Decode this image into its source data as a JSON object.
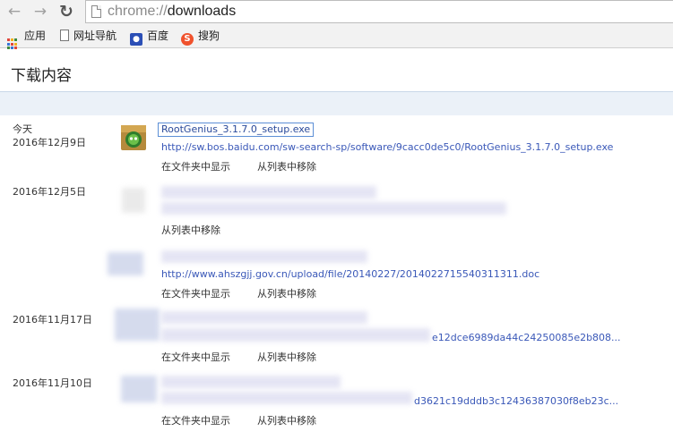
{
  "toolbar": {
    "url_scheme": "chrome://",
    "url_host": "downloads"
  },
  "bookmarks": [
    {
      "label": "应用",
      "icon": "apps-grid-icon"
    },
    {
      "label": "网址导航",
      "icon": "page-icon"
    },
    {
      "label": "百度",
      "icon": "baidu-paw-icon"
    },
    {
      "label": "搜狗",
      "icon": "sogou-icon"
    }
  ],
  "page": {
    "title": "下载内容"
  },
  "downloads": [
    {
      "date_top": "今天",
      "date": "2016年12月9日",
      "file_name": "RootGenius_3.1.7.0_setup.exe",
      "url": "http://sw.bos.baidu.com/sw-search-sp/software/9cacc0de5c0/RootGenius_3.1.7.0_setup.exe",
      "actions": [
        "在文件夹中显示",
        "从列表中移除"
      ]
    },
    {
      "date": "2016年12月5日",
      "actions": [
        "从列表中移除"
      ]
    },
    {
      "url": "http://www.ahszgjj.gov.cn/upload/file/20140227/20140227155403113​11.doc",
      "actions": [
        "在文件夹中显示",
        "从列表中移除"
      ]
    },
    {
      "date": "2016年11月17日",
      "url_tail": "e12dce6989da44c24250085e2b808...",
      "actions": [
        "在文件夹中显示",
        "从列表中移除"
      ]
    },
    {
      "date": "2016年11月10日",
      "url_tail": "d3621c19dddb3c12436387030f8eb23c...",
      "actions": [
        "在文件夹中显示",
        "从列表中移除"
      ]
    }
  ]
}
